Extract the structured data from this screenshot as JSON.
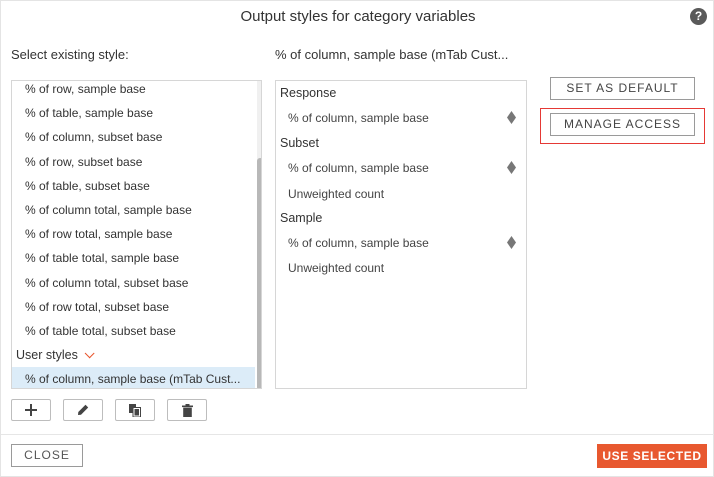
{
  "dialog": {
    "title": "Output styles for category variables",
    "help_glyph": "?"
  },
  "left_panel": {
    "label": "Select existing style:",
    "items": [
      "% of row, sample base",
      "% of table, sample base",
      "% of column, subset base",
      "% of row, subset base",
      "% of table, subset base",
      "% of column total, sample base",
      "% of row total, sample base",
      "% of table total, sample base",
      "% of column total, subset base",
      "% of row total, subset base",
      "% of table total, subset base"
    ],
    "group_label": "User styles",
    "selected_item": "% of column, sample base (mTab Cust...",
    "scroll": {
      "position_fraction": 0.25,
      "visible_fraction": 0.75
    },
    "tools": [
      "add-icon",
      "edit-icon",
      "copy-icon",
      "delete-icon"
    ]
  },
  "preview": {
    "label": "% of column, sample base (mTab Cust...",
    "sections": [
      {
        "header": "Response",
        "items": [
          {
            "text": "% of column, sample base",
            "sortable": true
          }
        ]
      },
      {
        "header": "Subset",
        "items": [
          {
            "text": "% of column, sample base",
            "sortable": true
          },
          {
            "text": "Unweighted count",
            "sortable": false
          }
        ]
      },
      {
        "header": "Sample",
        "items": [
          {
            "text": "% of column, sample base",
            "sortable": true
          },
          {
            "text": "Unweighted count",
            "sortable": false
          }
        ]
      }
    ]
  },
  "actions": {
    "set_default": "SET AS DEFAULT",
    "manage_access": "MANAGE ACCESS",
    "close": "CLOSE",
    "use_selected": "USE SELECTED"
  },
  "colors": {
    "accent": "#e8582f",
    "selected_row": "#dcecf8",
    "highlight": "#e53935"
  }
}
